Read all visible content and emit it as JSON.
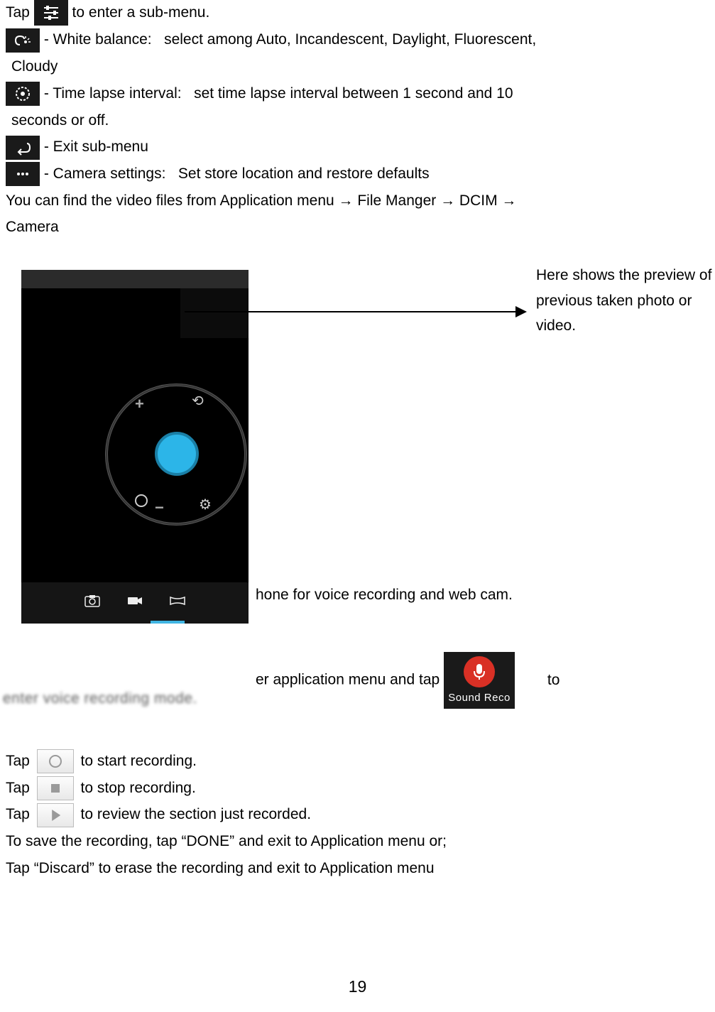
{
  "line1_a": "Tap",
  "line1_b": "to enter a sub-menu.",
  "white_balance": "- White balance:   select among Auto, Incandescent, Daylight, Fluorescent,",
  "cloudy": "Cloudy",
  "time_lapse": "- Time lapse interval:   set time lapse interval between 1 second and 10",
  "seconds_off": "seconds or off.",
  "exit_submenu": "- Exit sub-menu",
  "cam_settings": "- Camera settings:   Set store location and restore defaults",
  "videofiles_a": "You can find the video files from Application menu ",
  "arrow": "→",
  "videofiles_b": " File Manger ",
  "videofiles_c": " DCIM ",
  "camera": "Camera",
  "annotation": "Here shows the preview of previous taken photo or video.",
  "mic_line_frag": "hone for voice recording and web cam.",
  "app_menu_frag_a": "er application menu and tap",
  "app_menu_frag_b": "to",
  "voice_rec_blur": "enter voice recording mode.",
  "sound_rec_label": "Sound Reco",
  "tap": "Tap",
  "start_rec": "to start recording.",
  "stop_rec": "to stop recording.",
  "review_rec": "to review the section just recorded.",
  "save_line": "To save the recording, tap “DONE” and exit to Application menu or;",
  "discard_line": "Tap “Discard” to erase the recording and exit to Application menu",
  "page_number": "19"
}
